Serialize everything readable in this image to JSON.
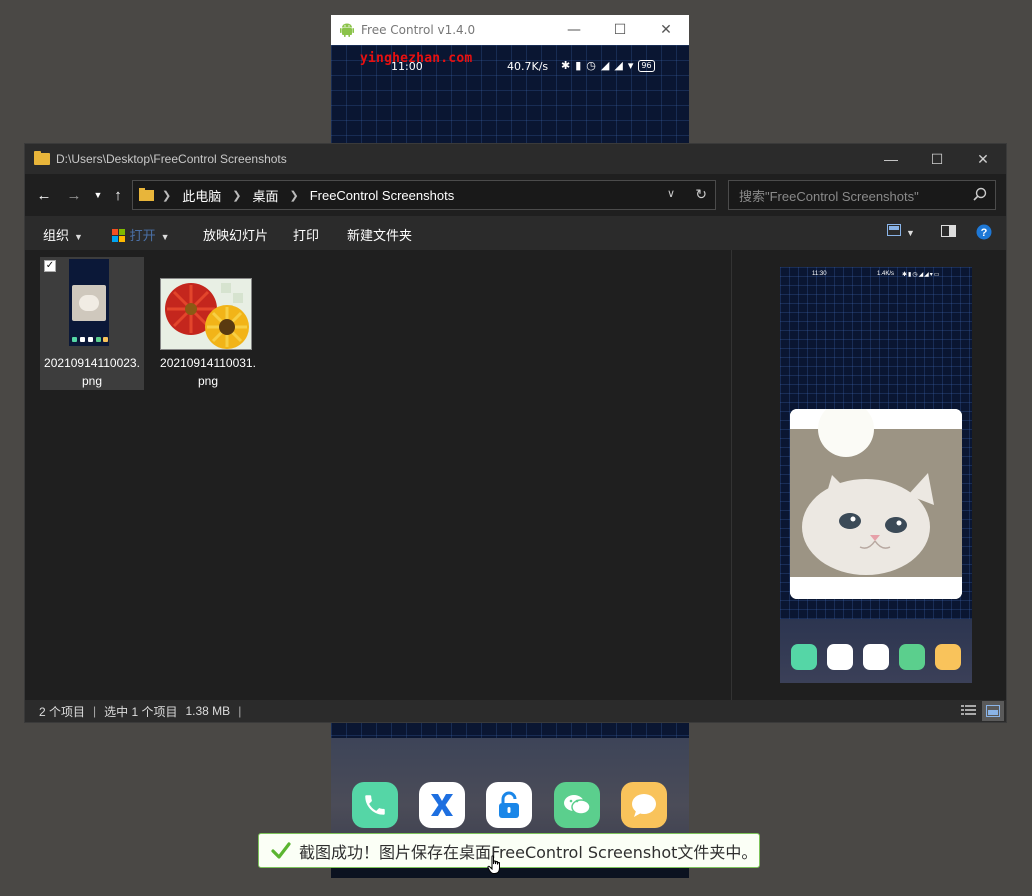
{
  "phone_window": {
    "title": "Free Control v1.4.0",
    "status_time": "11:00",
    "status_speed": "40.7K/s",
    "battery": "96",
    "watermark": "yinghezhan.com",
    "dock_apps": [
      "phone-icon",
      "x-app-icon",
      "lock-icon",
      "wechat-icon",
      "message-icon"
    ]
  },
  "explorer": {
    "title": "D:\\Users\\Desktop\\FreeControl Screenshots",
    "breadcrumb": [
      "此电脑",
      "桌面",
      "FreeControl Screenshots"
    ],
    "search_placeholder": "搜索\"FreeControl Screenshots\"",
    "toolbar": {
      "organize": "组织",
      "open": "打开",
      "slideshow": "放映幻灯片",
      "print": "打印",
      "new_folder": "新建文件夹"
    },
    "files": [
      {
        "name": "20210914110023.png",
        "selected": true
      },
      {
        "name": "20210914110031.png",
        "selected": false
      }
    ],
    "status": {
      "count": "2 个项目",
      "selection": "选中 1 个项目",
      "size": "1.38 MB"
    },
    "preview": {
      "status_time": "11:30",
      "status_speed": "1.4K/s"
    }
  },
  "toast": {
    "message": "截图成功！图片保存在桌面FreeControl Screenshot文件夹中。"
  },
  "colors": {
    "accent_green": "#7cc35a",
    "watermark_red": "#e81010",
    "folder_yellow": "#e8b53a"
  }
}
